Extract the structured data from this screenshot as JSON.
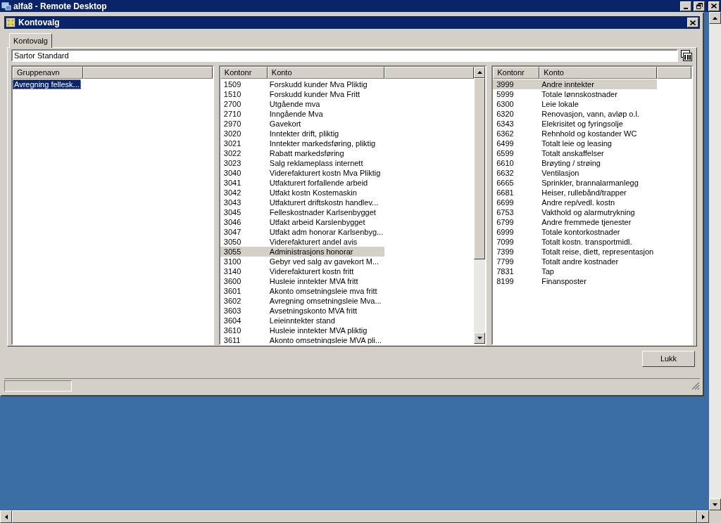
{
  "window": {
    "title": "alfa8 - Remote Desktop"
  },
  "dialog": {
    "title": "Kontovalg"
  },
  "tabs": [
    {
      "label": "Kontovalg",
      "selected": true
    }
  ],
  "chart_of_accounts": {
    "value": "Sartor Standard"
  },
  "group_list": {
    "focused": true,
    "columns": [
      "Gruppenavn"
    ],
    "rows": [
      {
        "cells": [
          "Avregning fellesk..."
        ],
        "selected": true
      }
    ]
  },
  "account_list": {
    "focused": false,
    "columns": [
      "Kontonr",
      "Konto"
    ],
    "rows": [
      {
        "cells": [
          "1509",
          "Forskudd kunder Mva Pliktig"
        ],
        "selected": false
      },
      {
        "cells": [
          "1510",
          "Forskudd kunder Mva Fritt"
        ],
        "selected": false
      },
      {
        "cells": [
          "2700",
          "Utgående mva"
        ],
        "selected": false
      },
      {
        "cells": [
          "2710",
          "Inngående Mva"
        ],
        "selected": false
      },
      {
        "cells": [
          "2970",
          "Gavekort"
        ],
        "selected": false
      },
      {
        "cells": [
          "3020",
          "Inntekter drift, pliktig"
        ],
        "selected": false
      },
      {
        "cells": [
          "3021",
          "Inntekter markedsføring, pliktig"
        ],
        "selected": false
      },
      {
        "cells": [
          "3022",
          "Rabatt markedsføring"
        ],
        "selected": false
      },
      {
        "cells": [
          "3023",
          "Salg reklameplass internett"
        ],
        "selected": false
      },
      {
        "cells": [
          "3040",
          "Viderefakturert kostn Mva Pliktig"
        ],
        "selected": false
      },
      {
        "cells": [
          "3041",
          "Utfakturert forfallende arbeid"
        ],
        "selected": false
      },
      {
        "cells": [
          "3042",
          "Utfakt kostn Kostemaskin"
        ],
        "selected": false
      },
      {
        "cells": [
          "3043",
          "Utfakturert driftskostn handlev..."
        ],
        "selected": false
      },
      {
        "cells": [
          "3045",
          "Felleskostnader Karlsenbygget"
        ],
        "selected": false
      },
      {
        "cells": [
          "3046",
          "Utfakt arbeid Karslenbygget"
        ],
        "selected": false
      },
      {
        "cells": [
          "3047",
          "Utfakt adm honorar Karlsenbyg..."
        ],
        "selected": false
      },
      {
        "cells": [
          "3050",
          "Viderefakturert andel avis"
        ],
        "selected": false
      },
      {
        "cells": [
          "3055",
          "Administrasjons honorar"
        ],
        "selected": true
      },
      {
        "cells": [
          "3100",
          "Gebyr ved salg av gavekort M..."
        ],
        "selected": false
      },
      {
        "cells": [
          "3140",
          "Viderefakturert kostn fritt"
        ],
        "selected": false
      },
      {
        "cells": [
          "3600",
          "Husleie inntekter MVA fritt"
        ],
        "selected": false
      },
      {
        "cells": [
          "3601",
          "Akonto omsetningsleie mva fritt"
        ],
        "selected": false
      },
      {
        "cells": [
          "3602",
          "Avregning omsetningsleie Mva..."
        ],
        "selected": false
      },
      {
        "cells": [
          "3603",
          "Avsetningskonto MVA fritt"
        ],
        "selected": false
      },
      {
        "cells": [
          "3604",
          "Leieinntekter stand"
        ],
        "selected": false
      },
      {
        "cells": [
          "3610",
          "Husleie inntekter MVA pliktig"
        ],
        "selected": false
      },
      {
        "cells": [
          "3611",
          "Akonto omsetningsleie MVA pli..."
        ],
        "selected": false
      }
    ]
  },
  "category_list": {
    "focused": false,
    "columns": [
      "Kontonr",
      "Konto"
    ],
    "rows": [
      {
        "cells": [
          "3999",
          "Andre inntekter"
        ],
        "selected": true
      },
      {
        "cells": [
          "5999",
          "Totale lønnskostnader"
        ],
        "selected": false
      },
      {
        "cells": [
          "6300",
          "Leie lokale"
        ],
        "selected": false
      },
      {
        "cells": [
          "6320",
          "Renovasjon, vann, avløp o.l."
        ],
        "selected": false
      },
      {
        "cells": [
          "6343",
          "Elekrisitet og fyringsolje"
        ],
        "selected": false
      },
      {
        "cells": [
          "6362",
          "Rehnhold og kostander WC"
        ],
        "selected": false
      },
      {
        "cells": [
          "6499",
          "Totalt leie og leasing"
        ],
        "selected": false
      },
      {
        "cells": [
          "6599",
          "Totalt anskaffelser"
        ],
        "selected": false
      },
      {
        "cells": [
          "6610",
          "Brøyting / strøing"
        ],
        "selected": false
      },
      {
        "cells": [
          "6632",
          "Ventilasjon"
        ],
        "selected": false
      },
      {
        "cells": [
          "6665",
          "Sprinkler, brannalarmanlegg"
        ],
        "selected": false
      },
      {
        "cells": [
          "6681",
          "Heiser, rullebånd/trapper"
        ],
        "selected": false
      },
      {
        "cells": [
          "6699",
          "Andre rep/vedl. kostn"
        ],
        "selected": false
      },
      {
        "cells": [
          "6753",
          "Vakthold og alarmutrykning"
        ],
        "selected": false
      },
      {
        "cells": [
          "6799",
          "Andre fremmede tjenester"
        ],
        "selected": false
      },
      {
        "cells": [
          "6999",
          "Totale kontorkostnader"
        ],
        "selected": false
      },
      {
        "cells": [
          "7099",
          "Totalt kostn. transportmidl."
        ],
        "selected": false
      },
      {
        "cells": [
          "7399",
          "Totalt reise, diett, representasjon"
        ],
        "selected": false
      },
      {
        "cells": [
          "7799",
          "Totalt andre kostnader"
        ],
        "selected": false
      },
      {
        "cells": [
          "7831",
          "Tap"
        ],
        "selected": false
      },
      {
        "cells": [
          "8199",
          "Finansposter"
        ],
        "selected": false
      }
    ]
  },
  "buttons": [
    "Lukk"
  ]
}
